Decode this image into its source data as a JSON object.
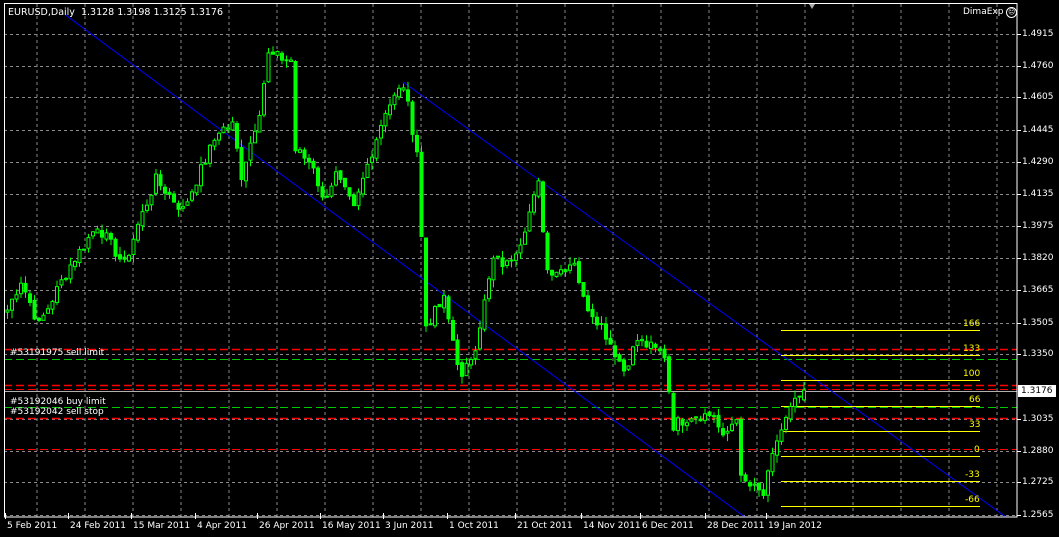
{
  "header": {
    "symbol_timeframe": "EURUSD,Daily",
    "ohlc": "1.3128 1.3198 1.3125 1.3176",
    "expert_name": "DimaExp",
    "expert_icon": "sad-face-icon"
  },
  "colors": {
    "background": "#000000",
    "candle": "#00ff00",
    "grid": "#8a8a8a",
    "channel": "#0000ff",
    "fib": "#ffff00",
    "order_pending": "#ff0000",
    "order_stop": "#00c800",
    "frame": "#ffffff"
  },
  "price_axis": [
    "1.4915",
    "1.4760",
    "1.4605",
    "1.4445",
    "1.4290",
    "1.4135",
    "1.3975",
    "1.3820",
    "1.3665",
    "1.3505",
    "1.3350",
    "1.3035",
    "1.2880",
    "1.2725",
    "1.2565"
  ],
  "current_price": "1.3176",
  "time_axis": [
    "5 Feb 2011",
    "24 Feb 2011",
    "15 Mar 2011",
    "4 Apr 2011",
    "26 Apr 2011",
    "16 May 2011",
    "3 Jun 2011",
    "1 Oct 2011",
    "21 Oct 2011",
    "14 Nov 2011",
    "6 Dec 2011",
    "28 Dec 2011",
    "19 Jan 2012"
  ],
  "orders": [
    {
      "label": "#53191975 sell limit",
      "price": 1.3376,
      "type": "pending"
    },
    {
      "label": "#53192046 buy limit",
      "price": 1.32,
      "type": "pending"
    },
    {
      "label": "#53192042 sell stop",
      "price": 1.304,
      "type": "pending"
    }
  ],
  "extra_levels": [
    {
      "price": 1.3327,
      "type": "stop"
    },
    {
      "price": 1.3183,
      "type": "pending"
    },
    {
      "price": 1.3092,
      "type": "stop"
    },
    {
      "price": 1.289,
      "type": "pending"
    }
  ],
  "fibonacci": [
    {
      "label": "166",
      "price": 1.3469
    },
    {
      "label": "133",
      "price": 1.3347
    },
    {
      "label": "100",
      "price": 1.3225
    },
    {
      "label": "66",
      "price": 1.3098
    },
    {
      "label": "33",
      "price": 1.2976
    },
    {
      "label": "0",
      "price": 1.2854
    },
    {
      "label": "-33",
      "price": 1.2731
    },
    {
      "label": "-66",
      "price": 1.2609
    }
  ],
  "channel": [
    {
      "name": "lower",
      "from": [
        13,
        1.5008
      ],
      "to": [
        164,
        1.2555
      ]
    },
    {
      "name": "upper",
      "from": [
        88,
        1.4681
      ],
      "to": [
        222,
        1.2555
      ]
    }
  ],
  "chart_data": {
    "type": "candlestick",
    "symbol": "EURUSD",
    "timeframe": "Daily",
    "ylim": [
      1.2565,
      1.4915
    ],
    "close_keypoints": [
      [
        0,
        1.3567
      ],
      [
        3,
        1.3713
      ],
      [
        7,
        1.3493
      ],
      [
        11,
        1.3664
      ],
      [
        14,
        1.3787
      ],
      [
        20,
        1.3982
      ],
      [
        26,
        1.3787
      ],
      [
        29,
        1.3982
      ],
      [
        33,
        1.4202
      ],
      [
        39,
        1.4055
      ],
      [
        43,
        1.4251
      ],
      [
        47,
        1.4446
      ],
      [
        50,
        1.447
      ],
      [
        52,
        1.4226
      ],
      [
        56,
        1.4544
      ],
      [
        58,
        1.4812
      ],
      [
        63,
        1.4788
      ],
      [
        64,
        1.4348
      ],
      [
        68,
        1.4275
      ],
      [
        70,
        1.4104
      ],
      [
        73,
        1.4226
      ],
      [
        77,
        1.4055
      ],
      [
        80,
        1.4275
      ],
      [
        84,
        1.4544
      ],
      [
        88,
        1.4666
      ],
      [
        91,
        1.4348
      ],
      [
        93,
        1.3493
      ],
      [
        97,
        1.3616
      ],
      [
        101,
        1.3225
      ],
      [
        104,
        1.3396
      ],
      [
        108,
        1.3811
      ],
      [
        111,
        1.3787
      ],
      [
        114,
        1.3909
      ],
      [
        118,
        1.4177
      ],
      [
        120,
        1.3764
      ],
      [
        123,
        1.3764
      ],
      [
        126,
        1.3811
      ],
      [
        128,
        1.3616
      ],
      [
        132,
        1.3493
      ],
      [
        137,
        1.3274
      ],
      [
        140,
        1.342
      ],
      [
        146,
        1.3347
      ],
      [
        148,
        1.3005
      ],
      [
        152,
        1.3054
      ],
      [
        157,
        1.3054
      ],
      [
        159,
        1.2932
      ],
      [
        162,
        1.3054
      ],
      [
        163,
        1.2736
      ],
      [
        168,
        1.2663
      ],
      [
        171,
        1.2932
      ],
      [
        174,
        1.3078
      ],
      [
        177,
        1.3176
      ]
    ]
  }
}
